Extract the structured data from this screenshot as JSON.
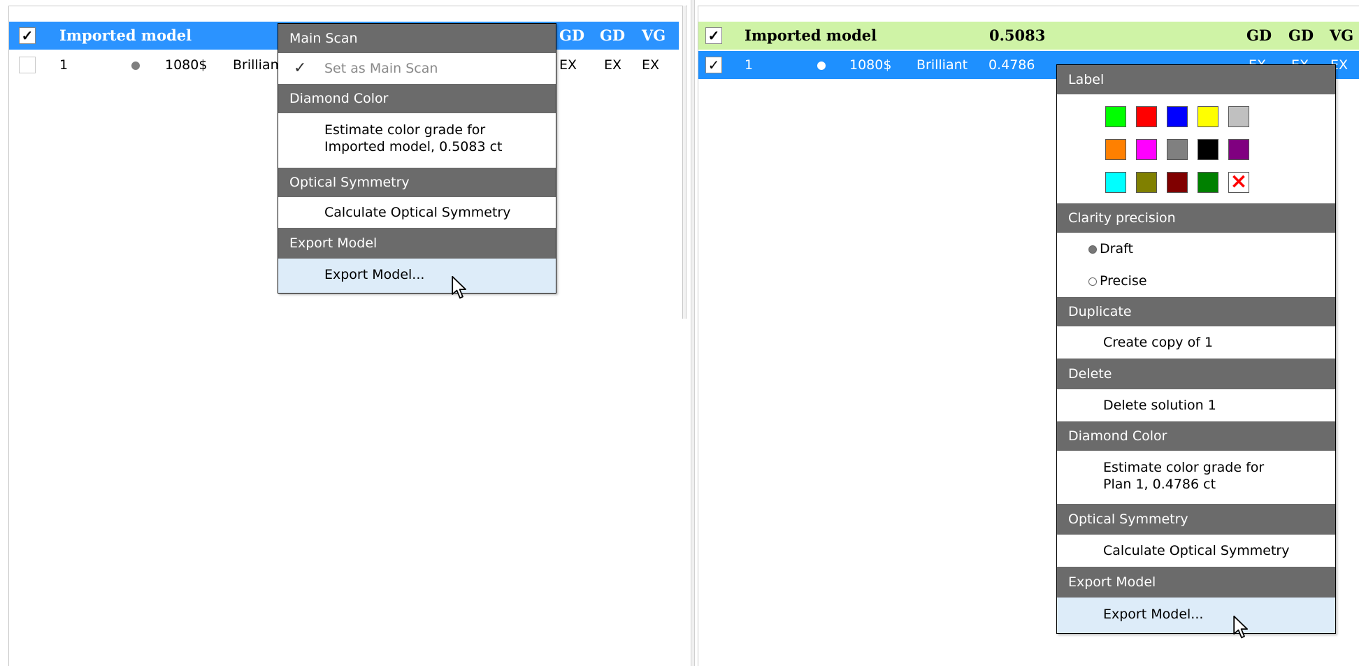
{
  "left_table": {
    "header": {
      "checked": true,
      "check_mark": "✓",
      "name": "Imported model",
      "cols": [
        "GD",
        "GD",
        "VG"
      ]
    },
    "rows": [
      {
        "id": "1",
        "dot_color": "#7f7f7f",
        "price": "1080$",
        "shape": "Brilliant",
        "cols": [
          "EX",
          "EX",
          "EX"
        ]
      }
    ]
  },
  "right_table": {
    "header": {
      "checked": true,
      "check_mark": "✓",
      "name": "Imported model",
      "weight": "0.5083",
      "cols": [
        "GD",
        "GD",
        "VG"
      ]
    },
    "rows": [
      {
        "checked": true,
        "check_mark": "✓",
        "id": "1",
        "dot_color": "#ffffff",
        "price": "1080$",
        "shape": "Brilliant",
        "weight": "0.4786",
        "cols": [
          "EX",
          "EX",
          "EX"
        ]
      }
    ]
  },
  "left_menu": {
    "sections": [
      {
        "title": "Main Scan",
        "items": [
          {
            "label": "Set as Main Scan",
            "checked": true,
            "check_mark": "✓",
            "disabled": true
          }
        ]
      },
      {
        "title": "Diamond Color",
        "items": [
          {
            "label_line1": "Estimate color grade for",
            "label_line2": "Imported model, 0.5083 ct"
          }
        ]
      },
      {
        "title": "Optical Symmetry",
        "items": [
          {
            "label": "Calculate Optical Symmetry"
          }
        ]
      },
      {
        "title": "Export Model",
        "items": [
          {
            "label": "Export Model...",
            "hover": true
          }
        ]
      }
    ]
  },
  "right_menu": {
    "label_section": {
      "title": "Label",
      "swatches": [
        "#00ff00",
        "#ff0000",
        "#0000ff",
        "#ffff00",
        "#c0c0c0",
        "#ff8000",
        "#ff00ff",
        "#808080",
        "#000000",
        "#800080",
        "#00ffff",
        "#808000",
        "#800000",
        "#008000"
      ],
      "clear_icon": "×",
      "clear_color": "#ff0000"
    },
    "clarity_section": {
      "title": "Clarity precision",
      "options": [
        {
          "label": "Draft",
          "selected": true
        },
        {
          "label": "Precise",
          "selected": false
        }
      ]
    },
    "duplicate_section": {
      "title": "Duplicate",
      "item": "Create copy of 1"
    },
    "delete_section": {
      "title": "Delete",
      "item": "Delete solution 1"
    },
    "color_section": {
      "title": "Diamond Color",
      "item_line1": "Estimate color grade for",
      "item_line2": "Plan 1, 0.4786 ct"
    },
    "symmetry_section": {
      "title": "Optical Symmetry",
      "item": "Calculate Optical Symmetry"
    },
    "export_section": {
      "title": "Export Model",
      "item": "Export Model...",
      "hover": true
    }
  },
  "colors": {
    "left_header_bg": "#2b93ff",
    "right_header_bg": "#cff3a6",
    "selected_row_bg": "#1e90ff",
    "menu_head_bg": "#6b6b6b",
    "menu_hover_bg": "#ddecf9"
  }
}
